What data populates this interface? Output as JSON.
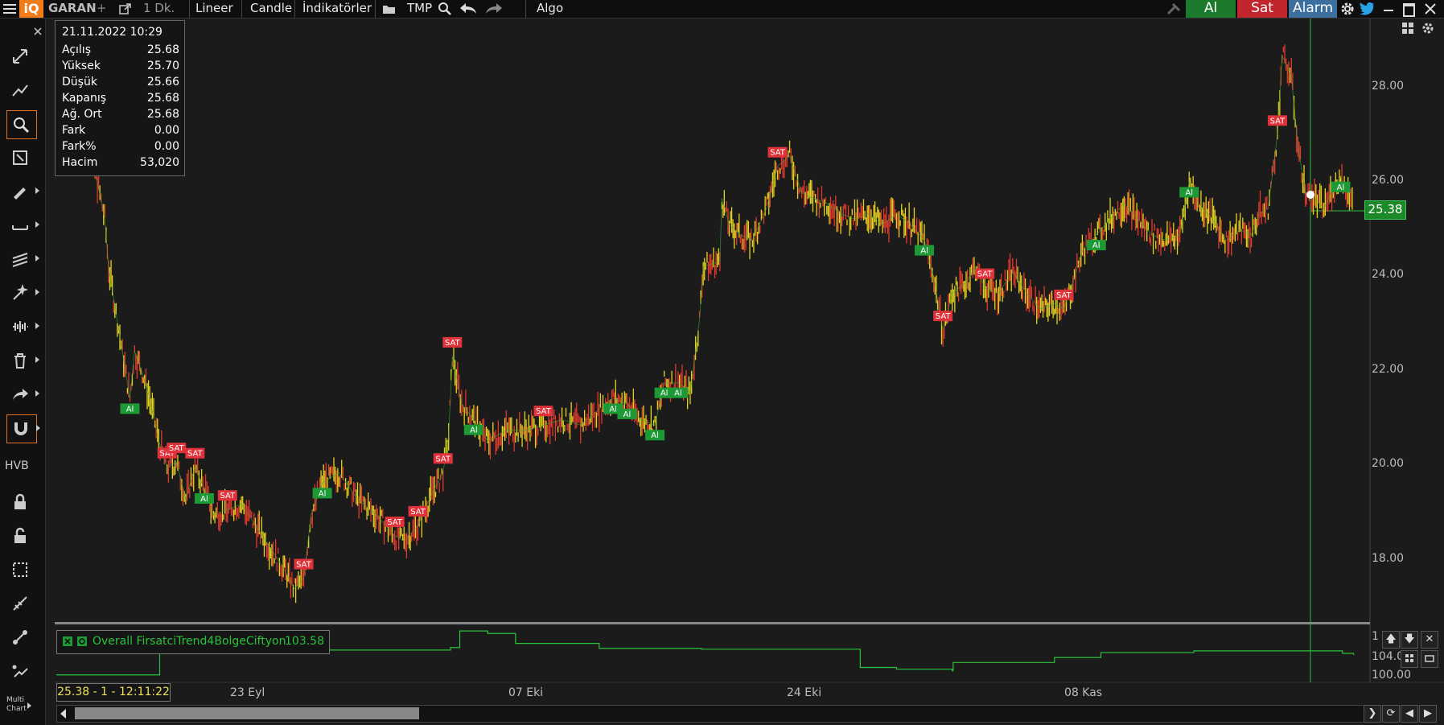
{
  "toolbar": {
    "logo": "iQ",
    "symbol": "GARAN",
    "plus": "+",
    "interval": "1 Dk.",
    "chart_type_lineer": "Lineer",
    "chart_type_candle": "Candle",
    "indicators": "İndikatörler",
    "tmp": "TMP",
    "algo": "Algo",
    "buy_label": "Al",
    "sell_label": "Sat",
    "alarm_label": "Alarm"
  },
  "sidebar": {
    "hvb": "HVB",
    "multi_chart_line1": "Multi",
    "multi_chart_line2": "Chart"
  },
  "info_box": {
    "datetime": "21.11.2022 10:29",
    "rows": [
      {
        "k": "Açılış",
        "v": "25.68"
      },
      {
        "k": "Yüksek",
        "v": "25.70"
      },
      {
        "k": "Düşük",
        "v": "25.66"
      },
      {
        "k": "Kapanış",
        "v": "25.68"
      },
      {
        "k": "Ağ. Ort",
        "v": "25.68"
      },
      {
        "k": "Fark",
        "v": "0.00"
      },
      {
        "k": "Fark%",
        "v": "0.00"
      },
      {
        "k": "Hacim",
        "v": "53,020"
      }
    ]
  },
  "price_axis": [
    "28.00",
    "26.00",
    "24.00",
    "22.00",
    "20.00",
    "18.00"
  ],
  "current_price": "25.38",
  "indicator": {
    "name": "Overall FirsatciTrend4BolgeCiftyon",
    "value": "103.58",
    "axis_labels": [
      "104.0",
      "100.00"
    ],
    "axis_partial": "1"
  },
  "status": "25.38 - 1 - 12:11:22",
  "dates": [
    "23 Eyl",
    "07 Eki",
    "24 Eki",
    "08 Kas"
  ],
  "markers": {
    "buy": "Al",
    "sell": "SAT"
  },
  "colors": {
    "up": "#e6d21f",
    "down": "#e03a2e",
    "buy_green": "#1d9a36",
    "sell_red": "#e0323a",
    "indicator_line": "#2bc23b"
  },
  "chart_data": {
    "type": "line",
    "title": "",
    "price_series": [
      [
        0,
        26.9
      ],
      [
        10,
        26.2
      ],
      [
        20,
        25.6
      ],
      [
        28,
        24.9
      ],
      [
        32,
        24.0
      ],
      [
        55,
        21.5
      ],
      [
        60,
        22.4
      ],
      [
        68,
        22.0
      ],
      [
        75,
        21.6
      ],
      [
        86,
        20.7
      ],
      [
        95,
        20.2
      ],
      [
        105,
        20.3
      ],
      [
        115,
        19.6
      ],
      [
        125,
        20.2
      ],
      [
        135,
        19.8
      ],
      [
        145,
        19.3
      ],
      [
        160,
        19.4
      ],
      [
        175,
        19.5
      ],
      [
        190,
        19.1
      ],
      [
        205,
        18.7
      ],
      [
        220,
        18.3
      ],
      [
        232,
        17.9
      ],
      [
        242,
        18.1
      ],
      [
        250,
        19.3
      ],
      [
        262,
        19.9
      ],
      [
        280,
        20.1
      ],
      [
        300,
        19.6
      ],
      [
        320,
        19.3
      ],
      [
        340,
        18.9
      ],
      [
        350,
        18.8
      ],
      [
        365,
        19.1
      ],
      [
        380,
        19.7
      ],
      [
        392,
        20.1
      ],
      [
        398,
        20.8
      ],
      [
        402,
        22.3
      ],
      [
        412,
        21.4
      ],
      [
        425,
        21.1
      ],
      [
        440,
        20.7
      ],
      [
        460,
        20.9
      ],
      [
        480,
        20.9
      ],
      [
        500,
        21.0
      ],
      [
        520,
        21.1
      ],
      [
        540,
        21.0
      ],
      [
        560,
        21.3
      ],
      [
        575,
        21.5
      ],
      [
        590,
        21.4
      ],
      [
        605,
        21.1
      ],
      [
        620,
        21.0
      ],
      [
        630,
        21.8
      ],
      [
        645,
        21.8
      ],
      [
        658,
        21.6
      ],
      [
        668,
        23.0
      ],
      [
        672,
        24.0
      ],
      [
        690,
        24.1
      ],
      [
        692,
        25.3
      ],
      [
        700,
        24.8
      ],
      [
        712,
        24.6
      ],
      [
        725,
        24.5
      ],
      [
        740,
        25.1
      ],
      [
        752,
        25.9
      ],
      [
        765,
        26.1
      ],
      [
        778,
        25.4
      ],
      [
        790,
        25.3
      ],
      [
        805,
        25.2
      ],
      [
        820,
        25.0
      ],
      [
        835,
        24.9
      ],
      [
        850,
        25.0
      ],
      [
        865,
        24.8
      ],
      [
        880,
        25.0
      ],
      [
        895,
        24.8
      ],
      [
        910,
        24.5
      ],
      [
        920,
        23.8
      ],
      [
        930,
        22.8
      ],
      [
        940,
        23.5
      ],
      [
        955,
        23.7
      ],
      [
        965,
        24.0
      ],
      [
        975,
        23.6
      ],
      [
        990,
        23.5
      ],
      [
        1005,
        23.9
      ],
      [
        1020,
        23.5
      ],
      [
        1035,
        23.2
      ],
      [
        1050,
        23.3
      ],
      [
        1060,
        23.2
      ],
      [
        1070,
        23.7
      ],
      [
        1080,
        24.3
      ],
      [
        1095,
        24.6
      ],
      [
        1110,
        24.9
      ],
      [
        1125,
        25.2
      ],
      [
        1140,
        24.9
      ],
      [
        1155,
        24.6
      ],
      [
        1170,
        24.5
      ],
      [
        1185,
        24.6
      ],
      [
        1195,
        25.6
      ],
      [
        1205,
        25.2
      ],
      [
        1220,
        24.9
      ],
      [
        1235,
        24.5
      ],
      [
        1250,
        24.7
      ],
      [
        1262,
        24.6
      ],
      [
        1270,
        25.0
      ],
      [
        1280,
        25.1
      ],
      [
        1290,
        26.5
      ],
      [
        1295,
        28.0
      ],
      [
        1305,
        27.6
      ],
      [
        1312,
        26.3
      ],
      [
        1320,
        25.4
      ],
      [
        1330,
        25.3
      ],
      [
        1340,
        25.1
      ],
      [
        1350,
        25.5
      ],
      [
        1358,
        25.7
      ],
      [
        1366,
        25.4
      ],
      [
        1372,
        25.4
      ]
    ],
    "indicator_series": [
      [
        0,
        100.5
      ],
      [
        86,
        100.5
      ],
      [
        87,
        104.0
      ],
      [
        100,
        104.4
      ],
      [
        140,
        103.5
      ],
      [
        260,
        103.5
      ],
      [
        400,
        103.8
      ],
      [
        410,
        105.8
      ],
      [
        440,
        105.5
      ],
      [
        470,
        104.3
      ],
      [
        560,
        103.7
      ],
      [
        670,
        103.6
      ],
      [
        840,
        103.6
      ],
      [
        841,
        101.4
      ],
      [
        880,
        101.2
      ],
      [
        940,
        101.0
      ],
      [
        941,
        102.0
      ],
      [
        1050,
        102.6
      ],
      [
        1100,
        103.2
      ],
      [
        1200,
        103.4
      ],
      [
        1358,
        103.4
      ],
      [
        1360,
        103.1
      ],
      [
        1372,
        102.9
      ]
    ],
    "ylim": [
      17.3,
      28.7
    ],
    "indicator_ylim": [
      99.8,
      106.2
    ]
  }
}
